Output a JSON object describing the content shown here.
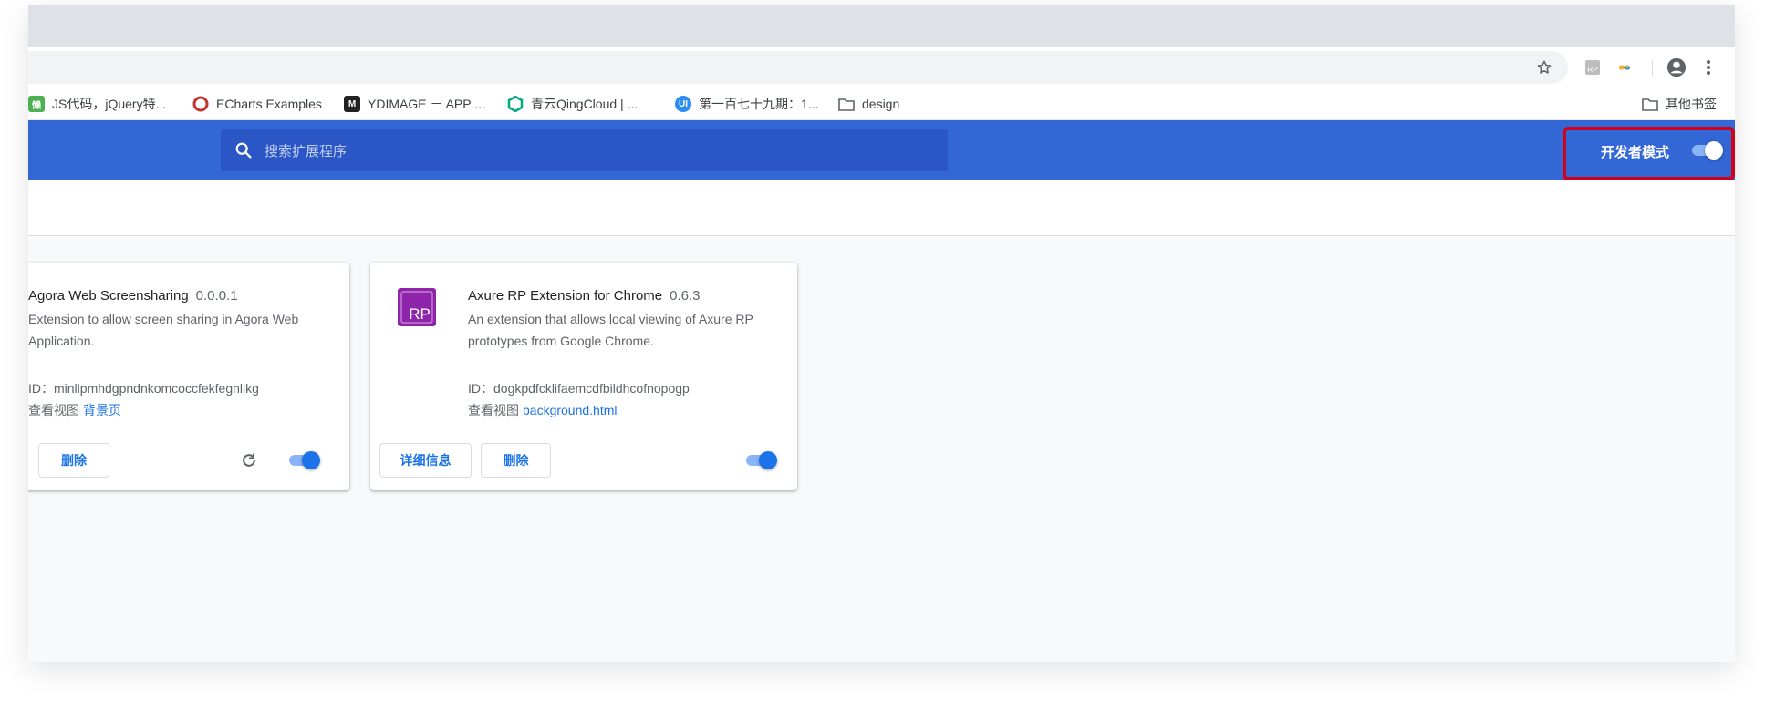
{
  "bookmarks": [
    {
      "icon": "jsdaima-favicon-icon",
      "label": "JS代码，jQuery特...",
      "color": "#4caf50",
      "glyph": "懒"
    },
    {
      "icon": "echarts-favicon-icon",
      "label": "ECharts Examples",
      "color": "#c23531",
      "glyph": ""
    },
    {
      "icon": "ydimage-favicon-icon",
      "label": "YDIMAGE － APP ...",
      "color": "#222222",
      "glyph": "M"
    },
    {
      "icon": "qingcloud-favicon-icon",
      "label": "青云QingCloud | ...",
      "color": "#00a97f",
      "glyph": ""
    },
    {
      "icon": "ui-favicon-icon",
      "label": "第一百七十九期：1...",
      "color": "#2d8cf0",
      "glyph": "UI"
    },
    {
      "icon": "folder-icon",
      "label": "design"
    }
  ],
  "other_bookmarks": {
    "icon": "folder-icon",
    "label": "其他书签"
  },
  "header": {
    "search_placeholder": "搜索扩展程序",
    "dev_mode_label": "开发者模式",
    "dev_mode_on": true
  },
  "extensions": [
    {
      "name": "Agora Web Screensharing",
      "version": "0.0.0.1",
      "description": "Extension to allow screen sharing in Agora Web Application.",
      "id": "ID：minllpmhdgpndnkomcoccfekfegnlikg",
      "views_label": "查看视图",
      "views_link": "背景页",
      "remove_label": "删除",
      "enabled": true
    },
    {
      "name": "Axure RP Extension for Chrome",
      "version": "0.6.3",
      "description": "An extension that allows local viewing of Axure RP prototypes from Google Chrome.",
      "id": "ID：dogkpdfcklifaemcdfbildhcofnopogp",
      "views_label": "查看视图",
      "views_link": "background.html",
      "details_label": "详细信息",
      "remove_label": "删除",
      "logo_text": "RP",
      "enabled": true
    }
  ],
  "colors": {
    "header_bg": "#3367d6",
    "search_bg": "#2a56c6",
    "accent": "#1a73e8",
    "highlight": "#d0021b"
  }
}
